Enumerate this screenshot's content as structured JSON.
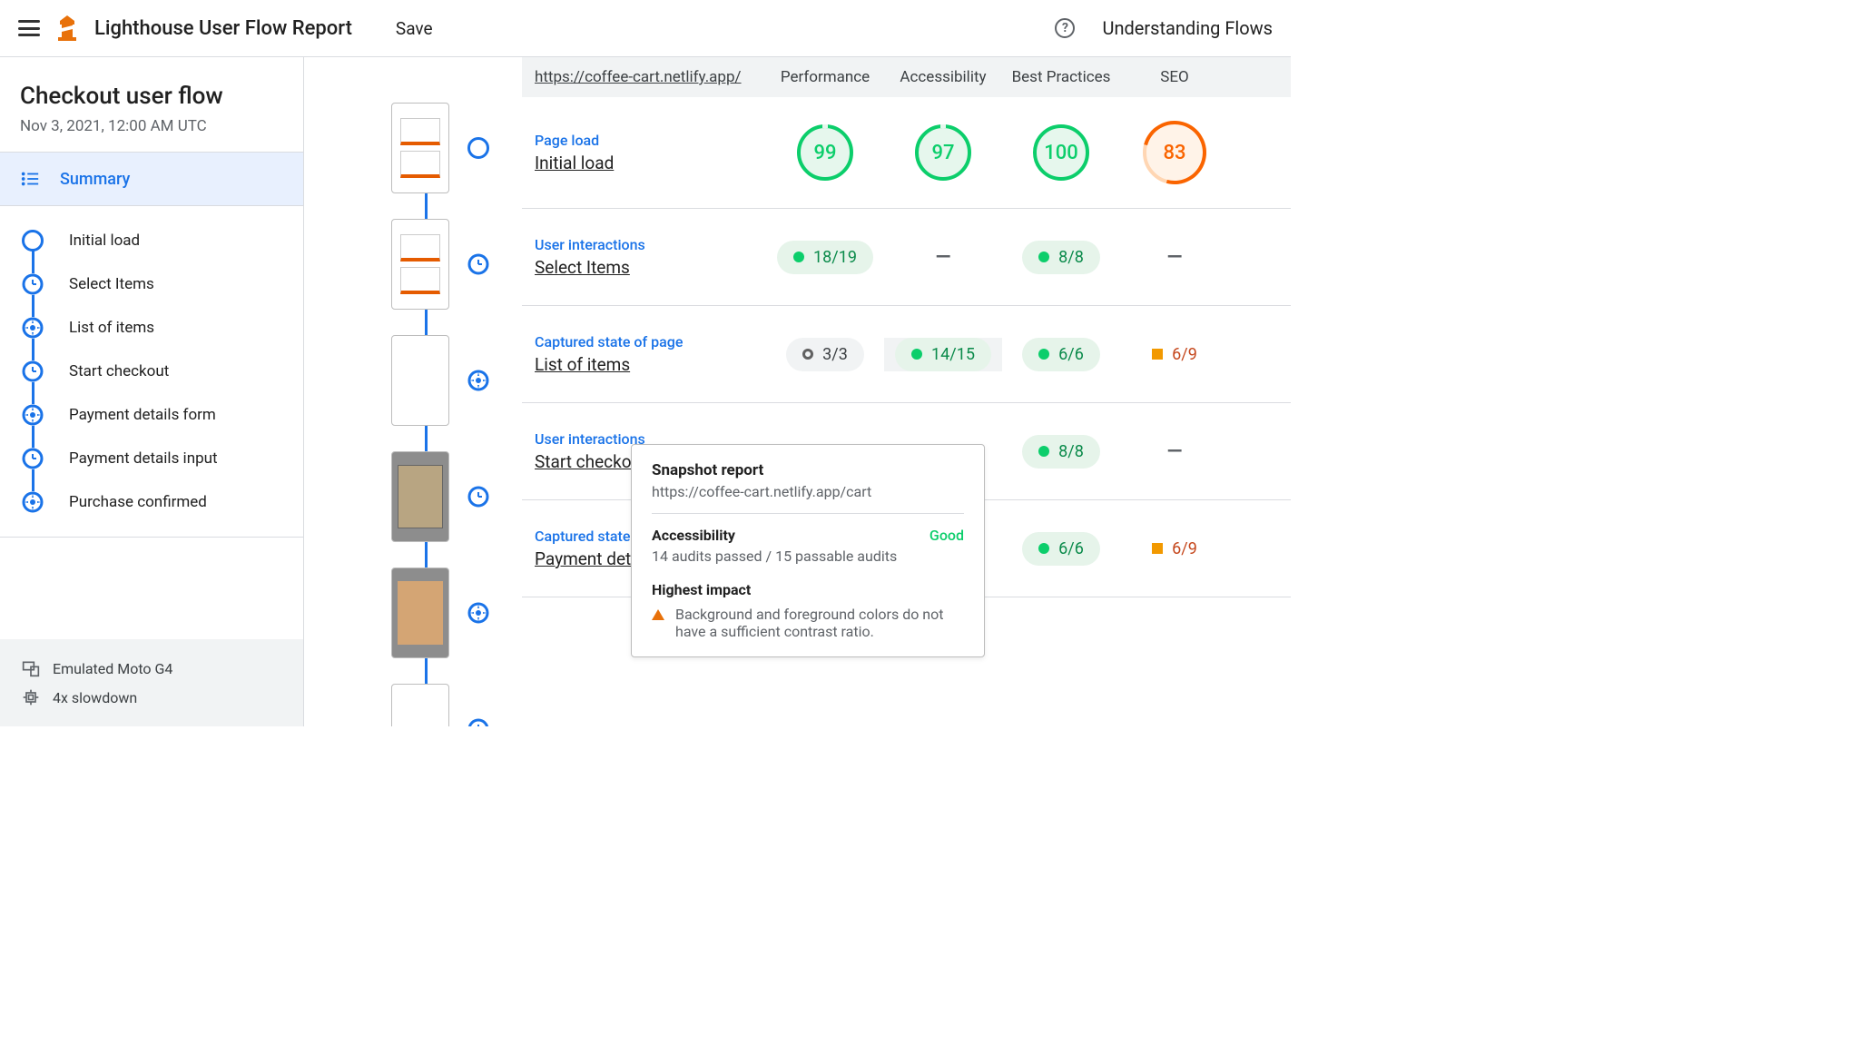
{
  "topbar": {
    "title": "Lighthouse User Flow Report",
    "save": "Save",
    "understanding": "Understanding Flows"
  },
  "sidebar": {
    "flow_title": "Checkout user flow",
    "flow_date": "Nov 3, 2021, 12:00 AM UTC",
    "summary": "Summary",
    "steps": [
      {
        "label": "Initial load",
        "type": "nav"
      },
      {
        "label": "Select Items",
        "type": "time"
      },
      {
        "label": "List of items",
        "type": "snap"
      },
      {
        "label": "Start checkout",
        "type": "time"
      },
      {
        "label": "Payment details form",
        "type": "snap"
      },
      {
        "label": "Payment details input",
        "type": "time"
      },
      {
        "label": "Purchase confirmed",
        "type": "snap"
      }
    ],
    "env": {
      "device": "Emulated Moto G4",
      "cpu": "4x slowdown"
    }
  },
  "table": {
    "url": "https://coffee-cart.netlify.app/",
    "columns": [
      "Performance",
      "Accessibility",
      "Best Practices",
      "SEO"
    ],
    "rows": [
      {
        "type": "Page load",
        "name": "Initial load",
        "cells": [
          {
            "kind": "gauge",
            "value": "99",
            "color": "green",
            "gap": true
          },
          {
            "kind": "gauge",
            "value": "97",
            "color": "green",
            "gap": true
          },
          {
            "kind": "gauge",
            "value": "100",
            "color": "green"
          },
          {
            "kind": "gauge",
            "value": "83",
            "color": "orange"
          }
        ]
      },
      {
        "type": "User interactions",
        "name": "Select Items",
        "cells": [
          {
            "kind": "chip",
            "value": "18/19",
            "color": "green"
          },
          {
            "kind": "dash"
          },
          {
            "kind": "chip",
            "value": "8/8",
            "color": "green"
          },
          {
            "kind": "dash"
          }
        ]
      },
      {
        "type": "Captured state of page",
        "name": "List of items",
        "cells": [
          {
            "kind": "chip",
            "value": "3/3",
            "color": "gray"
          },
          {
            "kind": "chip",
            "value": "14/15",
            "color": "green",
            "hl": true
          },
          {
            "kind": "chip",
            "value": "6/6",
            "color": "green"
          },
          {
            "kind": "chip",
            "value": "6/9",
            "color": "orange"
          }
        ]
      },
      {
        "type": "User interactions",
        "name": "Start checkout",
        "cells": [
          {
            "kind": "hidden"
          },
          {
            "kind": "hidden"
          },
          {
            "kind": "chip",
            "value": "8/8",
            "color": "green"
          },
          {
            "kind": "dash"
          }
        ]
      },
      {
        "type": "Captured state of page",
        "name": "Payment details form",
        "truncate": "Payment det",
        "cells": [
          {
            "kind": "hidden"
          },
          {
            "kind": "hidden"
          },
          {
            "kind": "chip",
            "value": "6/6",
            "color": "green"
          },
          {
            "kind": "chip",
            "value": "6/9",
            "color": "orange"
          }
        ]
      }
    ]
  },
  "tooltip": {
    "title": "Snapshot report",
    "url": "https://coffee-cart.netlify.app/cart",
    "category": "Accessibility",
    "rating": "Good",
    "audits": "14 audits passed / 15 passable audits",
    "impact_label": "Highest impact",
    "impact_text": "Background and foreground colors do not have a sufficient contrast ratio."
  }
}
